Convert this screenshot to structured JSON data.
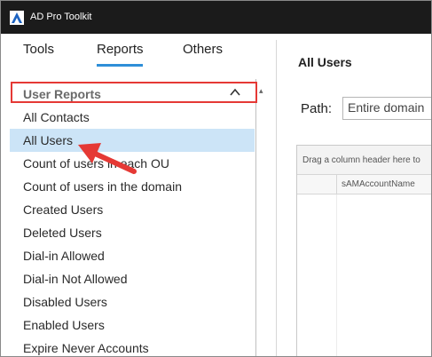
{
  "window": {
    "title": "AD Pro Toolkit"
  },
  "tabs": [
    {
      "label": "Tools"
    },
    {
      "label": "Reports"
    },
    {
      "label": "Others"
    }
  ],
  "sidebar": {
    "group_title": "User Reports",
    "items": [
      {
        "label": "All Contacts"
      },
      {
        "label": "All Users"
      },
      {
        "label": "Count of users in each OU"
      },
      {
        "label": "Count of users in the domain"
      },
      {
        "label": "Created Users"
      },
      {
        "label": "Deleted Users"
      },
      {
        "label": "Dial-in Allowed"
      },
      {
        "label": "Dial-in Not Allowed"
      },
      {
        "label": "Disabled Users"
      },
      {
        "label": "Enabled Users"
      },
      {
        "label": "Expire Never Accounts"
      }
    ],
    "selected_item": "All Users"
  },
  "main": {
    "title": "All Users",
    "path_label": "Path:",
    "path_value": "Entire domain",
    "group_panel_hint": "Drag a column header here to",
    "columns": [
      "sAMAccountName"
    ]
  },
  "colors": {
    "titlebar": "#1b1b1b",
    "accent": "#2e8fd8",
    "selection": "#cce4f7",
    "annotation": "#e53935"
  }
}
